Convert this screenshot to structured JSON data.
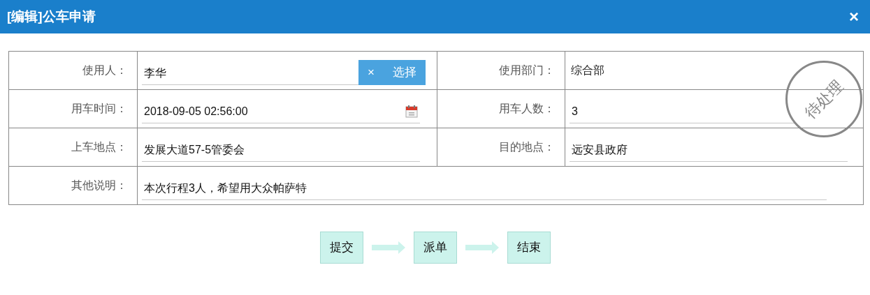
{
  "window": {
    "title": "[编辑]公车申请",
    "close": "×"
  },
  "form": {
    "rows": [
      {
        "cells": [
          {
            "label": "使用人：",
            "value": "李华",
            "kind": "picker",
            "clear": "×",
            "button": "选择"
          },
          {
            "label": "使用部门：",
            "value": "综合部",
            "kind": "plain"
          }
        ]
      },
      {
        "cells": [
          {
            "label": "用车时间：",
            "value": "2018-09-05 02:56:00",
            "kind": "date"
          },
          {
            "label": "用车人数：",
            "value": "3",
            "kind": "text"
          }
        ]
      },
      {
        "cells": [
          {
            "label": "上车地点：",
            "value": "发展大道57-5管委会",
            "kind": "text"
          },
          {
            "label": "目的地点：",
            "value": "远安县政府",
            "kind": "text"
          }
        ]
      },
      {
        "cells": [
          {
            "label": "其他说明：",
            "value": "本次行程3人，希望用大众帕萨特",
            "kind": "text"
          }
        ]
      }
    ]
  },
  "stamp": {
    "text": "待处理"
  },
  "steps": [
    "提交",
    "派单",
    "结束"
  ]
}
